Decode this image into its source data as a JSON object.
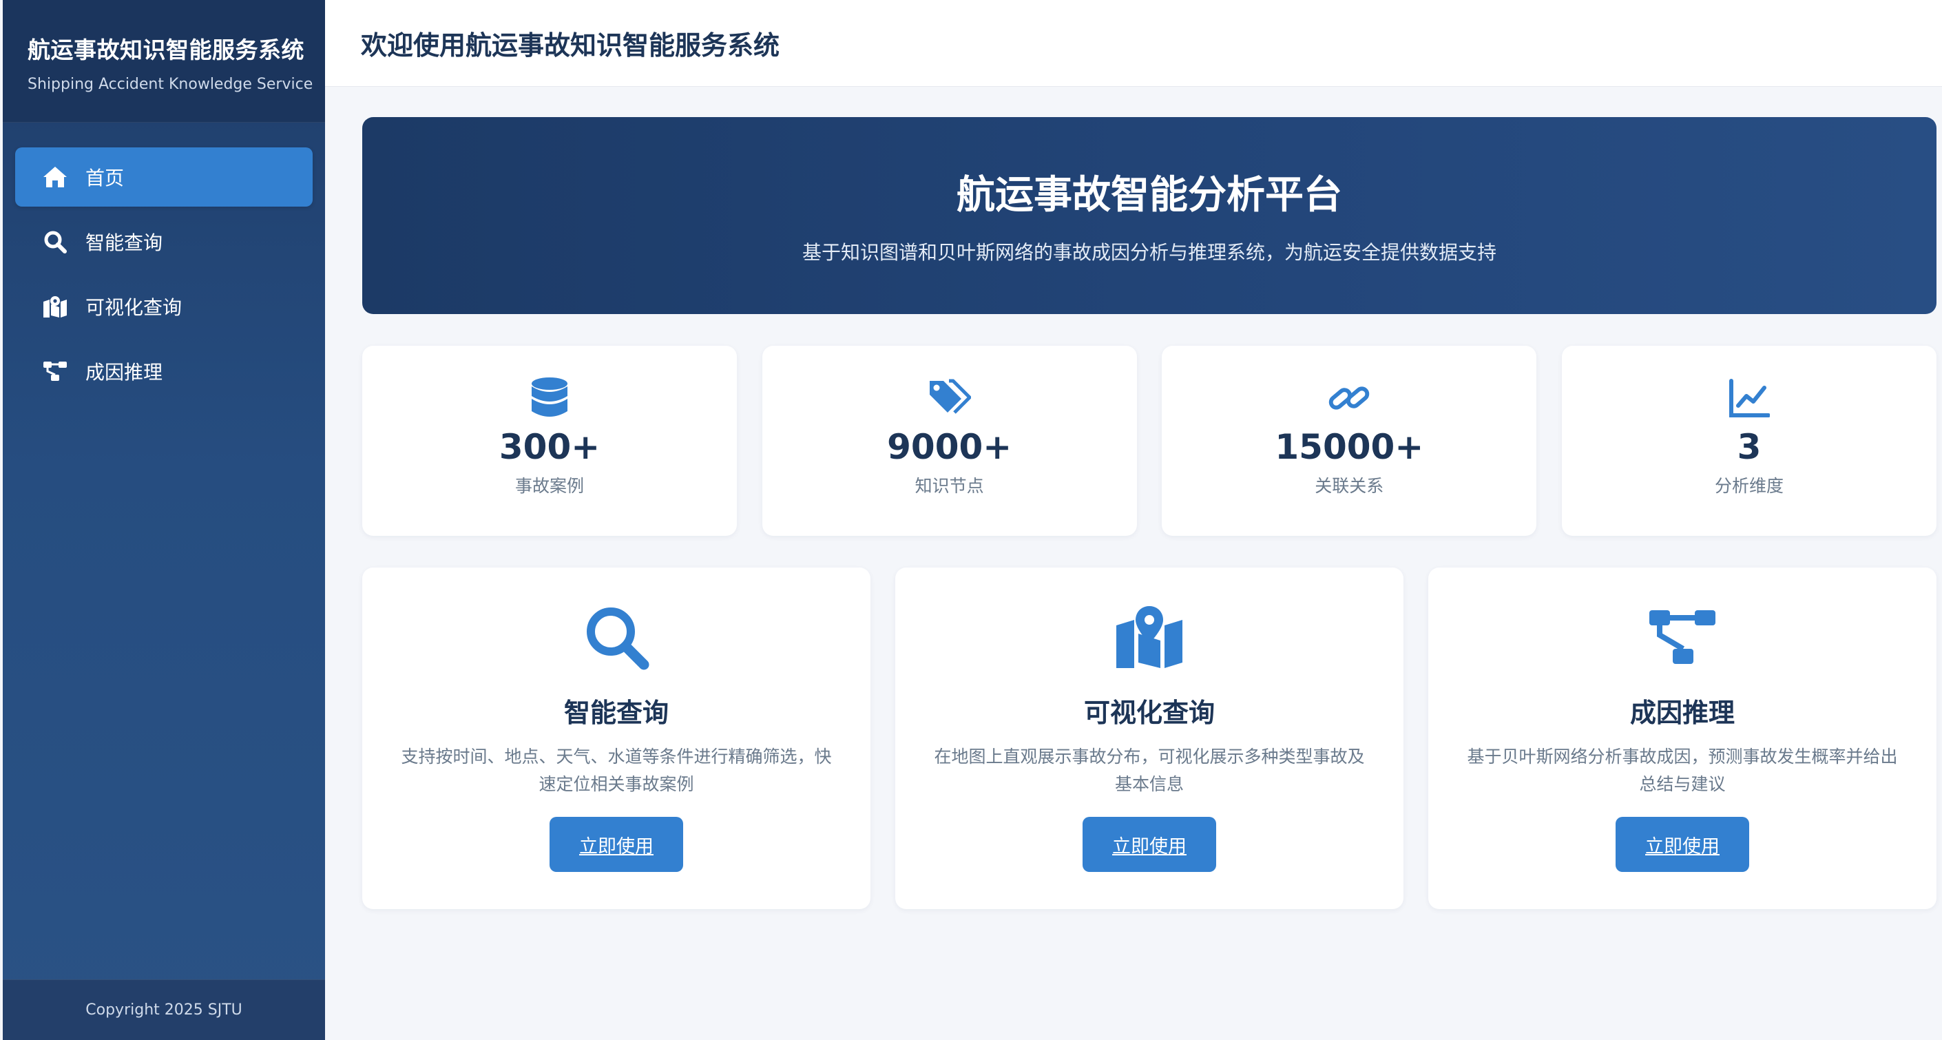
{
  "sidebar": {
    "brand_title": "航运事故知识智能服务系统",
    "brand_subtitle": "Shipping Accident Knowledge Service",
    "items": [
      {
        "label": "首页",
        "icon": "home-icon",
        "active": true
      },
      {
        "label": "智能查询",
        "icon": "search-icon",
        "active": false
      },
      {
        "label": "可视化查询",
        "icon": "map-icon",
        "active": false
      },
      {
        "label": "成因推理",
        "icon": "sitemap-icon",
        "active": false
      }
    ],
    "footer": "Copyright 2025 SJTU"
  },
  "header": {
    "title": "欢迎使用航运事故知识智能服务系统"
  },
  "hero": {
    "title": "航运事故智能分析平台",
    "subtitle": "基于知识图谱和贝叶斯网络的事故成因分析与推理系统，为航运安全提供数据支持"
  },
  "stats": [
    {
      "value": "300+",
      "label": "事故案例",
      "icon": "database-icon"
    },
    {
      "value": "9000+",
      "label": "知识节点",
      "icon": "tags-icon"
    },
    {
      "value": "15000+",
      "label": "关联关系",
      "icon": "link-icon"
    },
    {
      "value": "3",
      "label": "分析维度",
      "icon": "chart-line-icon"
    }
  ],
  "features": [
    {
      "title": "智能查询",
      "description": "支持按时间、地点、天气、水道等条件进行精确筛选，快速定位相关事故案例",
      "button_label": "立即使用",
      "icon": "search-icon"
    },
    {
      "title": "可视化查询",
      "description": "在地图上直观展示事故分布，可视化展示多种类型事故及基本信息",
      "button_label": "立即使用",
      "icon": "map-location-icon"
    },
    {
      "title": "成因推理",
      "description": "基于贝叶斯网络分析事故成因，预测事故发生概率并给出总结与建议",
      "button_label": "立即使用",
      "icon": "sitemap-icon"
    }
  ],
  "colors": {
    "accent": "#3380d0",
    "sidebar": "#23467a",
    "heading": "#1d3557"
  }
}
